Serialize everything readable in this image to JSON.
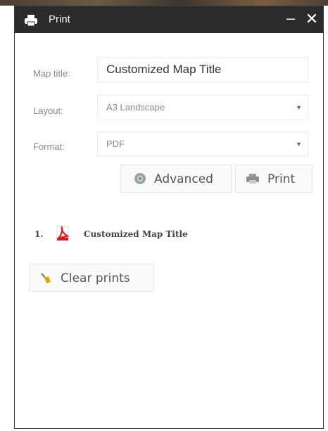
{
  "window": {
    "title": "Print",
    "minimize_glyph": "–",
    "close_glyph": "✕"
  },
  "form": {
    "map_title": {
      "label": "Map title:",
      "value": "Customized Map Title"
    },
    "layout": {
      "label": "Layout:",
      "value": "A3 Landscape"
    },
    "format": {
      "label": "Format:",
      "value": "PDF"
    }
  },
  "buttons": {
    "advanced": "Advanced",
    "print": "Print",
    "clear": "Clear prints"
  },
  "prints": [
    {
      "number": "1.",
      "title": "Customized Map Title",
      "icon": "pdf-icon"
    }
  ],
  "icons": {
    "title": "printer-icon",
    "advanced": "gear-icon",
    "print": "printer-icon",
    "clear": "broom-icon"
  },
  "colors": {
    "titlebar": "#2b2b2b",
    "pdf_red": "#d21e1e",
    "broom_yellow": "#e0a800"
  }
}
